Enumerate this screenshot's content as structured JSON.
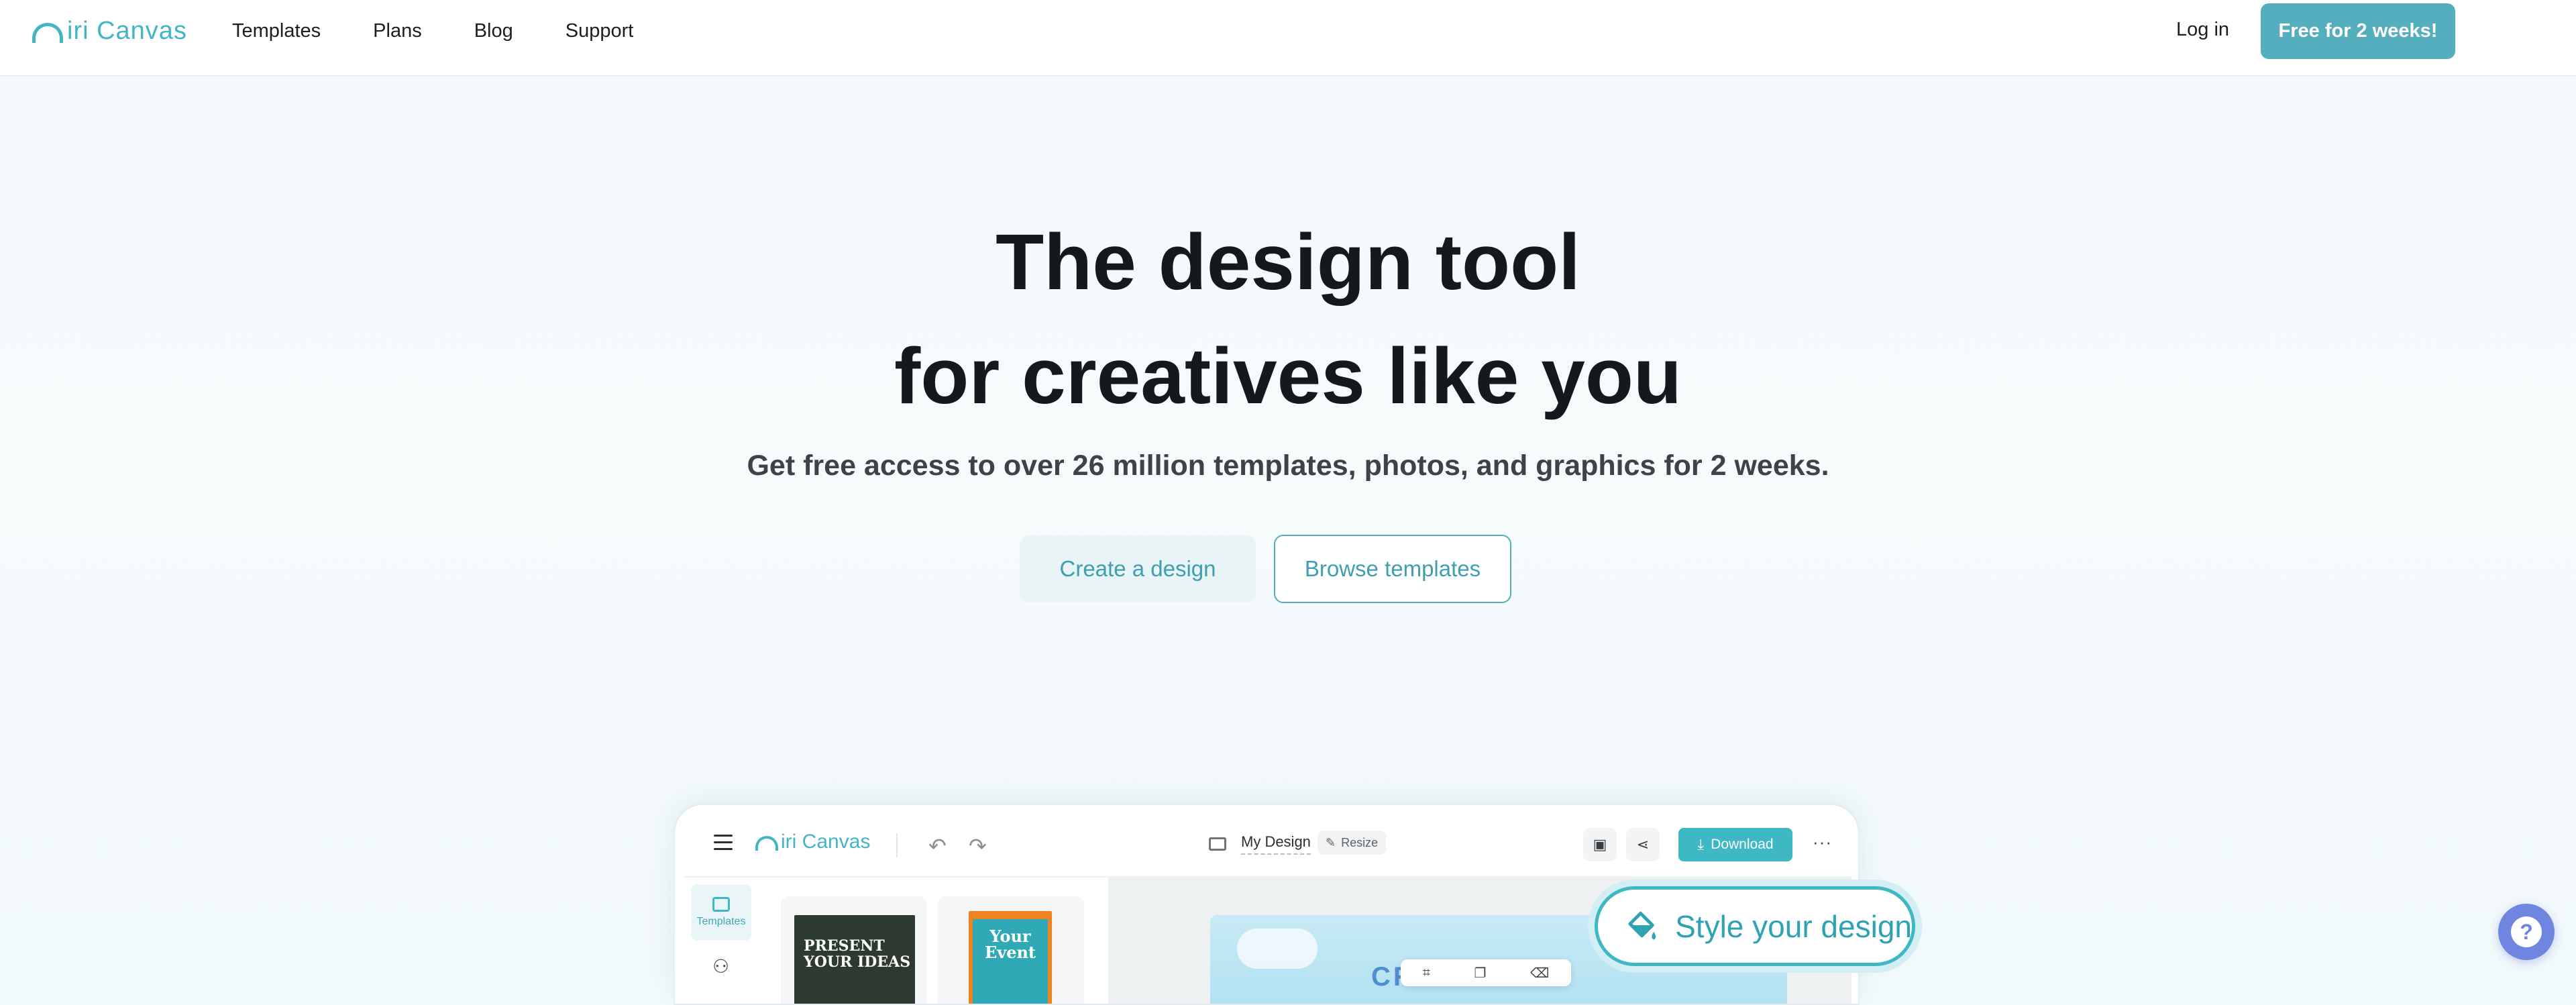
{
  "brand": {
    "logo_text": "iri Canvas",
    "accent": "#55aebd"
  },
  "nav": {
    "links": [
      "Templates",
      "Plans",
      "Blog",
      "Support"
    ],
    "login_label": "Log in",
    "cta_label": "Free for 2 weeks!"
  },
  "hero": {
    "title_line1": "The design tool",
    "title_line2": "for creatives like you",
    "subtitle": "Get free access to over 26 million templates, photos, and graphics for 2 weeks.",
    "create_label": "Create a design",
    "browse_label": "Browse templates"
  },
  "editor": {
    "logo_text": "iri Canvas",
    "design_name": "My Design",
    "resize_label": "Resize",
    "download_label": "Download",
    "more_label": "···",
    "sidebar_templates_label": "Templates",
    "thumb1_text": "PRESENT YOUR IDEAS",
    "thumb2_text": "Your Event",
    "canvas_ghost_text": "CR        ND"
  },
  "style_pill": {
    "label": "Style your design"
  },
  "help": {
    "label": "?"
  }
}
